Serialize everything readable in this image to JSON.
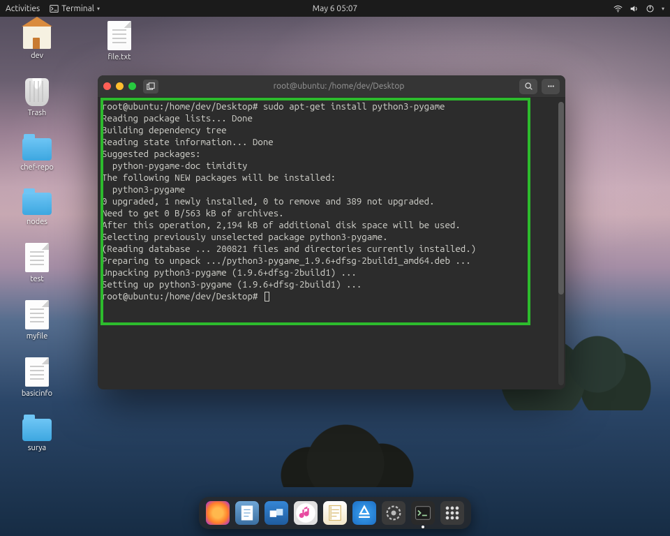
{
  "topbar": {
    "activities": "Activities",
    "app_name": "Terminal",
    "datetime": "May 6  05:07"
  },
  "desktop_icons": {
    "r1c1": "dev",
    "r1c2": "file.txt",
    "trash": "Trash",
    "chef": "chef-repo",
    "nodes": "nodes",
    "test": "test",
    "myfile": "myfile",
    "basicinfo": "basicinfo",
    "surya": "surya"
  },
  "terminal": {
    "title": "root@ubuntu: /home/dev/Desktop",
    "prompt1": "root@ubuntu:/home/dev/Desktop# ",
    "command1": "sudo apt-get install python3-pygame",
    "lines": [
      "Reading package lists... Done",
      "Building dependency tree",
      "Reading state information... Done",
      "Suggested packages:",
      "  python-pygame-doc timidity",
      "The following NEW packages will be installed:",
      "  python3-pygame",
      "0 upgraded, 1 newly installed, 0 to remove and 389 not upgraded.",
      "Need to get 0 B/563 kB of archives.",
      "After this operation, 2,194 kB of additional disk space will be used.",
      "Selecting previously unselected package python3-pygame.",
      "(Reading database ... 200821 files and directories currently installed.)",
      "Preparing to unpack .../python3-pygame_1.9.6+dfsg-2build1_amd64.deb ...",
      "Unpacking python3-pygame (1.9.6+dfsg-2build1) ...",
      "Setting up python3-pygame (1.9.6+dfsg-2build1) ..."
    ],
    "prompt2": "root@ubuntu:/home/dev/Desktop# "
  },
  "dock": {
    "items": [
      "firefox",
      "text-editor",
      "files",
      "music",
      "notes",
      "app-store",
      "settings",
      "terminal",
      "apps-grid"
    ]
  },
  "colors": {
    "highlight_border": "#2dbb2d",
    "term_bg": "#2c2c2c",
    "topbar_bg": "#1b1b1b"
  }
}
